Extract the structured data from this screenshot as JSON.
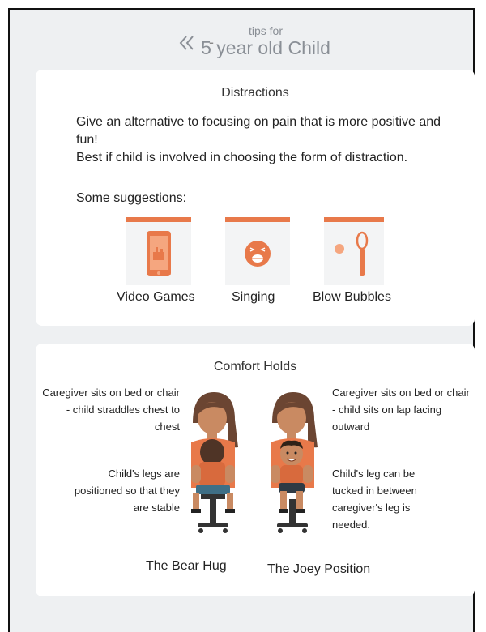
{
  "header": {
    "tips_for": "tips for",
    "title": "5 year old Child",
    "dash": "-"
  },
  "distractions": {
    "title": "Distractions",
    "para1": "Give an alternative to focusing on pain that is more positive and fun!",
    "para2": "Best if child is involved in choosing the form of distraction.",
    "suggestions_heading": "Some suggestions:",
    "suggestions": [
      {
        "label": "Video Games",
        "icon": "tablet-icon"
      },
      {
        "label": "Singing",
        "icon": "singing-face-icon"
      },
      {
        "label": "Blow Bubbles",
        "icon": "bubble-wand-icon"
      }
    ]
  },
  "comfort_holds": {
    "title": "Comfort Holds",
    "bear_hug": {
      "text1": "Caregiver sits on bed or chair - child straddles chest to chest",
      "text2": "Child's legs are positioned so that they are stable",
      "name": "The Bear Hug"
    },
    "joey": {
      "text1": "Caregiver sits on bed or chair - child sits on lap facing outward",
      "text2": "Child's leg can be tucked in between caregiver's leg is needed.",
      "name": "The Joey Position"
    }
  },
  "colors": {
    "accent": "#e8794a",
    "background": "#eef0f2",
    "card": "#ffffff",
    "muted_text": "#8a8f96"
  }
}
